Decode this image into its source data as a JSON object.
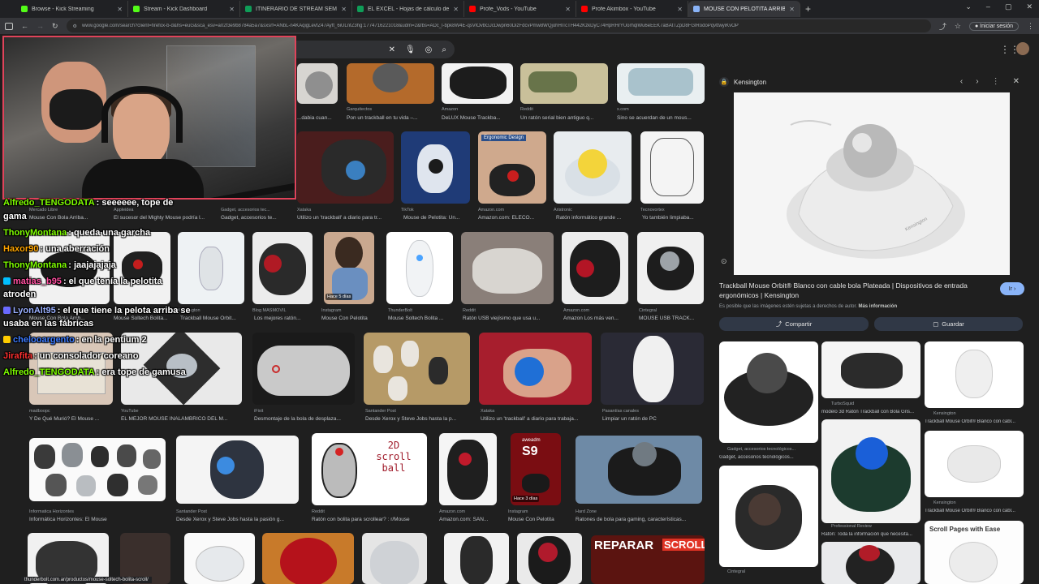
{
  "tabs": [
    {
      "title": "Browse - Kick Streaming",
      "color": "#53fc18",
      "active": false
    },
    {
      "title": "Stream - Kick Dashboard",
      "color": "#53fc18",
      "active": false
    },
    {
      "title": "ITINERARIO DE STREAM SEMANAL",
      "color": "#0f9d58",
      "active": false
    },
    {
      "title": "EL EXCEL - Hojas de cálculo de Google",
      "color": "#0f9d58",
      "active": false
    },
    {
      "title": "Profe_Vods - YouTube",
      "color": "#ff0000",
      "active": false
    },
    {
      "title": "Profe Akimbox - YouTube",
      "color": "#ff0000",
      "active": false
    },
    {
      "title": "MOUSE CON PELOTITA ARRIBA",
      "color": "#8ab4f8",
      "active": true
    }
  ],
  "address": {
    "url": "www.google.com/search?client=firefox-b-d&hs=euG&sca_esv=a02f3e9b8784a5a7&sxsrf=ANbL-n4KAqigLevfZ47Ayft_6iULnfZ3hg:1774716221018&udm=2&fbs=ADc_l-bpk8W4E-qsVlOvbGJcDwpn60DizFdcvPmw8WQjohHlTcTH442KzkDyC74HpRHrYUorhqlWu6eEEK7aBAtTZpD8FGlRodoPqvttwyiKvOP",
    "signin": "Iniciar sesión"
  },
  "icons": {
    "lock": "🔒",
    "share": "⤴",
    "bookmark": "▢"
  },
  "grid": {
    "row0": [
      {
        "cap": "...dabia cuan...",
        "src": ""
      },
      {
        "cap": "Pon un trackball en tu vida –...",
        "src": "Garquitectos"
      },
      {
        "cap": "DeLUX Mouse Trackba...",
        "src": "Amazon"
      },
      {
        "cap": "Un ratón serial bien antiguo q...",
        "src": "Reddit"
      },
      {
        "cap": "Sino se acuerdan de un mous...",
        "src": "x.com"
      }
    ],
    "row1": [
      {
        "cap": "Mouse Con Bola Arriba...",
        "src": "Mercado Libre"
      },
      {
        "cap": "El sucesor del Mighty Mouse podría l...",
        "src": "Appleidea"
      },
      {
        "cap": "Gadget, accesorios te...",
        "src": "Gadget, accesorios tec..."
      },
      {
        "cap": "Utilizo un 'trackball' a diario para tr...",
        "src": "Xataka"
      },
      {
        "cap": "Mouse de Pelotita: Un...",
        "src": "TikTok"
      },
      {
        "cap": "Amazon.com: ELECO...",
        "src": "Amazon.com"
      },
      {
        "cap": "Ratón informático grande ...",
        "src": "Aristronic"
      },
      {
        "cap": "Yo también limpiaba...",
        "src": "Tecnovortex"
      }
    ],
    "row1_banner": "Ergonomic Design",
    "row2": [
      {
        "cap": "Mouse Con Bola Arrib...",
        "src": ""
      },
      {
        "cap": "Mouse Soltech Bolita...",
        "src": ""
      },
      {
        "cap": "Trackball Mouse Orbit...",
        "src": "Kensington"
      },
      {
        "cap": "Los mejores ratón...",
        "src": "Blog MASMOVIL"
      },
      {
        "cap": "Mouse Con Pelotita",
        "src": "Instagram"
      },
      {
        "cap": "Mouse Soltech Bolita ...",
        "src": "ThunderBolt"
      },
      {
        "cap": "Ratón USB viejísimo que usa u...",
        "src": "Reddit"
      },
      {
        "cap": "Amazon Los más ven...",
        "src": "Amazon.com"
      },
      {
        "cap": "MOUSE USB TRACK...",
        "src": "Cintegral"
      }
    ],
    "row2_badge": "Hace 5 días",
    "row3": [
      {
        "cap": "Y De Qué Murió? El Mouse ...",
        "src": "madboopc"
      },
      {
        "cap": "EL MEJOR MOUSE INALÁMBRICO DEL M...",
        "src": "YouTube"
      },
      {
        "cap": "Desmontaje de la bola de desplaza...",
        "src": "iFixit"
      },
      {
        "cap": "Desde Xerox y Steve Jobs hasta la p...",
        "src": "Santander Post"
      },
      {
        "cap": "Utilizo un 'trackball' a diario para trabaja...",
        "src": "Xataka"
      },
      {
        "cap": "Limpiar un ratón de PC",
        "src": "Pasantías canales"
      }
    ],
    "row4": [
      {
        "cap": "Informática Horizontes: El Mouse",
        "src": "Informatica Horizontes"
      },
      {
        "cap": "Desde Xerox y Steve Jobs hasta la pasión g...",
        "src": "Santander Post"
      },
      {
        "cap": "Ratón con bolita para scrollear? : r/Mouse",
        "src": "Reddit"
      },
      {
        "cap": "Amazon.com: SAN...",
        "src": "Amazon.com"
      },
      {
        "cap": "Mouse Con Pelotita",
        "src": "Instagram"
      },
      {
        "cap": "Ratones de bola para gaming, características...",
        "src": "Hard Zone"
      }
    ],
    "scroll_text": [
      "2D",
      "scroll",
      "ball"
    ],
    "s9_text": "S9",
    "s9_top": "aweadm",
    "row4_badge": "Hace 3 días",
    "repair_text": [
      "REPARAR",
      "SCROLL"
    ]
  },
  "chat": [
    {
      "user": "Alfredo_TENGODATA",
      "color": "#7fff00",
      "msg": ": seeeeee, tope de",
      "badge": ""
    },
    {
      "user": "",
      "color": "#ffffff",
      "msg": "gama",
      "badge": ""
    },
    {
      "user": "ThonyMontana",
      "color": "#7fff00",
      "msg": ": queda una garcha",
      "badge": ""
    },
    {
      "user": "Haxor90",
      "color": "#ffa500",
      "msg": ": una aberración",
      "badge": ""
    },
    {
      "user": "ThonyMontana",
      "color": "#7fff00",
      "msg": ": jaajajajaja",
      "badge": ""
    },
    {
      "user": "matias_b95",
      "color": "#ff4fa0",
      "msg": ": el que tenía la pelotita",
      "badge": "#00bfff"
    },
    {
      "user": "",
      "color": "#ffffff",
      "msg": "atroden",
      "badge": ""
    },
    {
      "user": "LyonAlt95",
      "color": "#9ab0ff",
      "msg": ": el que tiene la pelota arriba se",
      "badge": "#6a6aff"
    },
    {
      "user": "",
      "color": "#ffffff",
      "msg": "usaba en las fábricas",
      "badge": ""
    },
    {
      "user": "chelooargento",
      "color": "#3d7bff",
      "msg": ": en la pentium 2",
      "badge": "#ffcc00"
    },
    {
      "user": "Jirafita",
      "color": "#ff3030",
      "msg": ": un consolador coreano",
      "badge": ""
    },
    {
      "user": "Alfredo_TENGODATA",
      "color": "#7fff00",
      "msg": ": era tope de gamusa",
      "badge": ""
    }
  ],
  "panel": {
    "source": "Kensington",
    "title": "Trackball Mouse Orbit® Blanco con cable bola Plateada | Dispositivos de entrada ergonómicos | Kensington",
    "note": "Es posible que las imágenes estén sujetas a derechos de autor.",
    "note_link": "Más información",
    "go": "Ir",
    "share": "Compartir",
    "save": "Guardar",
    "brand_mark": "Kensington",
    "related": [
      {
        "cap": "Gadget, accesorios tecnológicos...",
        "src": "Gadget, accesorios tecnológicos..."
      },
      {
        "cap": "modelo 3d Ratón Trackball con Bola Gris...",
        "src": "TurboSquid"
      },
      {
        "cap": "Trackball Mouse Orbit® Blanco con cabl...",
        "src": "Kensington"
      },
      {
        "cap": "Ratón: Toda la información que necesita...",
        "src": "Professional Review"
      },
      {
        "cap": "Trackball Mouse Orbit® Blanco con cabl...",
        "src": "Kensington"
      },
      {
        "cap": "",
        "src": "Cintegral"
      }
    ],
    "scroll_pages": "Scroll Pages with Ease"
  },
  "status_url": "thunderbolt.com.ar/productos/mouse-soltech-bolita-scroll/"
}
